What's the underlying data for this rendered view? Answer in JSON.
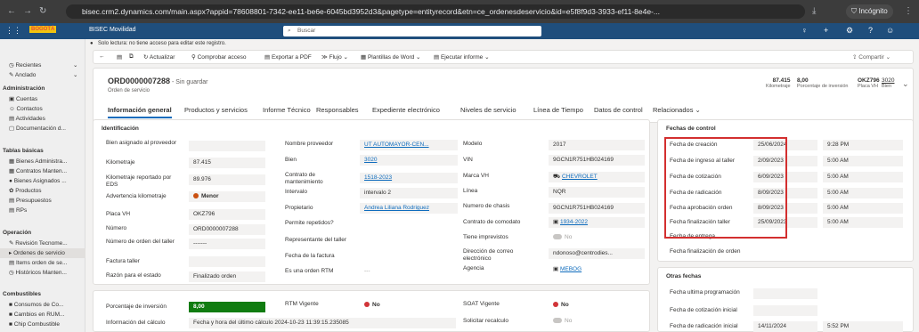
{
  "browser": {
    "url": "bisec.crm2.dynamics.com/main.aspx?appid=78608801-7342-ee11-be6e-6045bd3952d3&pagetype=entityrecord&etn=ce_ordenesdeservicio&id=e5f8f9d3-3933-ef11-8e4e-...",
    "incognito_label": "Incógnito"
  },
  "appbar": {
    "brand": "BOGOTÁ",
    "app_name": "BISEC Movilidad",
    "search_placeholder": "Buscar"
  },
  "sidebar": {
    "top": [
      {
        "label": "Recientes"
      },
      {
        "label": "Anclado"
      }
    ],
    "groups": [
      {
        "title": "Administración",
        "items": [
          "Cuentas",
          "Contactos",
          "Actividades",
          "Documentación d..."
        ]
      },
      {
        "title": "Tablas básicas",
        "items": [
          "Bienes Administra...",
          "Contratos Manten...",
          "Bienes Asignados ...",
          "Productos",
          "Presupuestos",
          "RPs"
        ]
      },
      {
        "title": "Operación",
        "items": [
          "Revisión Tecnome...",
          "Ordenes de servicio",
          "Items orden de se...",
          "Históricos Manten..."
        ]
      },
      {
        "title": "Combustibles",
        "items": [
          "Consumos de Co...",
          "Cambios en RUM...",
          "Chip Combustible"
        ]
      }
    ]
  },
  "message": "Solo lectura: no tiene acceso para editar este registro.",
  "commands": [
    "Actualizar",
    "Comprobar acceso",
    "Exportar a PDF",
    "Flujo",
    "Plantillas de Word",
    "Ejecutar informe",
    "Compartir"
  ],
  "header": {
    "record_id": "ORD0000007288",
    "unsaved": " - Sin guardar",
    "record_type": "Orden de servicio",
    "fields": [
      {
        "value": "87.415",
        "label": "Kilometraje"
      },
      {
        "value": "8,00",
        "label": "Porcentaje de inversión"
      },
      {
        "value": "OKZ796",
        "label": "Placa VH"
      },
      {
        "value": "3020",
        "label": "Bien"
      }
    ]
  },
  "tabs": [
    "Información general",
    "Productos y servicios",
    "Informe Técnico",
    "Responsables",
    "Expediente electrónico",
    "Niveles de servicio",
    "Línea de Tiempo",
    "Datos de control",
    "Relacionados"
  ],
  "identificacion": {
    "title": "Identificación",
    "col1": [
      {
        "label": "Bien asignado al proveedor",
        "value": ""
      },
      {
        "label": "Kilometraje",
        "value": "87.415"
      },
      {
        "label": "Kilometraje reportado por EDS",
        "value": "89.976"
      },
      {
        "label": "Advertencia kilometraje",
        "value": "Menor"
      },
      {
        "label": "Placa VH",
        "value": "OKZ796"
      },
      {
        "label": "Número",
        "value": "ORD0000007288"
      },
      {
        "label": "Número de orden del taller",
        "value": "-------"
      },
      {
        "label": "Factura taller",
        "value": ""
      },
      {
        "label": "Razón para el estado",
        "value": "Finalizado orden"
      }
    ],
    "col2": [
      {
        "label": "Nombre proveedor",
        "value": "UT AUTOMAYOR-CEN..."
      },
      {
        "label": "Bien",
        "value": "3020"
      },
      {
        "label": "Contrato de mantenimiento",
        "value": "1518-2023"
      },
      {
        "label": "Intervalo",
        "value": "intervalo 2"
      },
      {
        "label": "Propietario",
        "value": "Andrea Liliana Rodriguez"
      },
      {
        "label": "Permite repetidos?",
        "value": ""
      },
      {
        "label": "Representante del taller",
        "value": ""
      },
      {
        "label": "Fecha de la factura",
        "value": ""
      },
      {
        "label": "Es una orden RTM",
        "value": "---"
      }
    ],
    "col3": [
      {
        "label": "Modelo",
        "value": "2017"
      },
      {
        "label": "VIN",
        "value": "9GCN1R751HB024169"
      },
      {
        "label": "Marca VH",
        "value": "CHEVROLET"
      },
      {
        "label": "Línea",
        "value": "NQR"
      },
      {
        "label": "Numero de chasis",
        "value": "9GCN1R751HB024169"
      },
      {
        "label": "Contrato de comodato",
        "value": "1934-2022"
      },
      {
        "label": "Tiene imprevistos",
        "value": "No"
      },
      {
        "label": "Dirección de correo electrónico",
        "value": "ndonoso@centrodies..."
      },
      {
        "label": "Agencia",
        "value": "MEBOG"
      }
    ]
  },
  "fechas_control": {
    "title": "Fechas de control",
    "rows": [
      {
        "label": "Fecha de creación",
        "date": "25/06/2024",
        "time": "9:28 PM"
      },
      {
        "label": "Fecha de ingreso al taller",
        "date": "2/09/2023",
        "time": "5:00 AM"
      },
      {
        "label": "Fecha de cotización",
        "date": "6/09/2023",
        "time": "5:00 AM"
      },
      {
        "label": "Fecha de radicación",
        "date": "8/09/2023",
        "time": "5:00 AM"
      },
      {
        "label": "Fecha aprobación orden",
        "date": "8/09/2023",
        "time": "5:00 AM"
      },
      {
        "label": "Fecha finalización taller",
        "date": "25/09/2023",
        "time": "5:00 AM"
      },
      {
        "label": "Fecha de entrega",
        "date": "",
        "time": ""
      },
      {
        "label": "Fecha finalización de orden",
        "date": "",
        "time": ""
      }
    ]
  },
  "otras_fechas": {
    "title": "Otras fechas",
    "rows": [
      {
        "label": "Fecha ultima programación",
        "date": "",
        "time": ""
      },
      {
        "label": "Fecha de cotización inicial",
        "date": "",
        "time": ""
      },
      {
        "label": "Fecha de radicación inicial",
        "date": "14/11/2024",
        "time": "5:52 PM"
      }
    ]
  },
  "bottom": {
    "porcentaje_label": "Porcentaje de inversión",
    "porcentaje_value": "8,00",
    "info_label": "Información del cálculo",
    "info_value": "Fecha y hora del último cálculo 2024-10-23 11:39:15.235085",
    "rtm_label": "RTM Vigente",
    "rtm_value": "No",
    "soat_label": "SOAT Vigente",
    "soat_value": "No",
    "recalculo_label": "Solicitar recalculo",
    "recalculo_value": "No"
  },
  "colors": {
    "accent": "#0f6cbd",
    "appbar": "#1f4e7c",
    "highlight": "#d32f2f",
    "green": "#107c10",
    "red_dot": "#d13438"
  }
}
